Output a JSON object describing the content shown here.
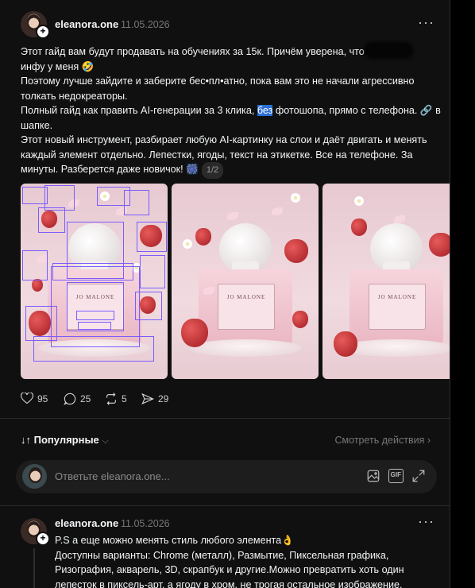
{
  "post": {
    "username": "eleanora.one",
    "date": "11.05.2026",
    "more": "···",
    "text_parts": {
      "line1a": "Этот гайд вам будут продавать на обучениях за 15к. Причём уверена, что",
      "line2": "инфу у меня 🤣",
      "line3": "Поэтому лучше зайдите и заберите бес•пл•атно, пока вам это не начали агрессивно толкать недокреаторы.",
      "line4a": "Полный гайд как править AI-генерации за 3 клика,",
      "highlight": "без",
      "line4b": "фотошопа, прямо с телефона. 🔗 в шапке.",
      "line5": "Этот новый инструмент, разбирает любую AI-картинку на слои и даёт двигать и менять каждый элемент отдельно. Лепестки, ягоды, текст на этикетке. Все на телефоне. За минуты. Разберется даже новичок! 🎆",
      "pager": "1/2"
    },
    "images": [
      {
        "brand": "JO MALONE"
      },
      {
        "brand": "JO MALONE"
      },
      {
        "brand": "JO MALONE"
      }
    ],
    "actions": {
      "likes": "95",
      "comments": "25",
      "reposts": "5",
      "shares": "29"
    }
  },
  "sort": {
    "label": "Популярные",
    "activity_link": "Смотреть действия"
  },
  "reply": {
    "placeholder": "Ответьте eleanora.one..."
  },
  "comment": {
    "username": "eleanora.one",
    "date": "11.05.2026",
    "more": "···",
    "line1": "P.S а еще можно менять стиль любого элемента👌",
    "line2": "Доступны варианты: Chrome (металл), Размытие, Пиксельная графика, Ризография, акварель, 3D, скрапбук и другие.Можно превратить хоть один лепесток в пиксель-арт, а ягоду в хром, не трогая остальное изображение."
  },
  "colors": {
    "background": "#101010",
    "highlight": "#2a6fd6",
    "bbox_overlay": "#7a5cff"
  }
}
